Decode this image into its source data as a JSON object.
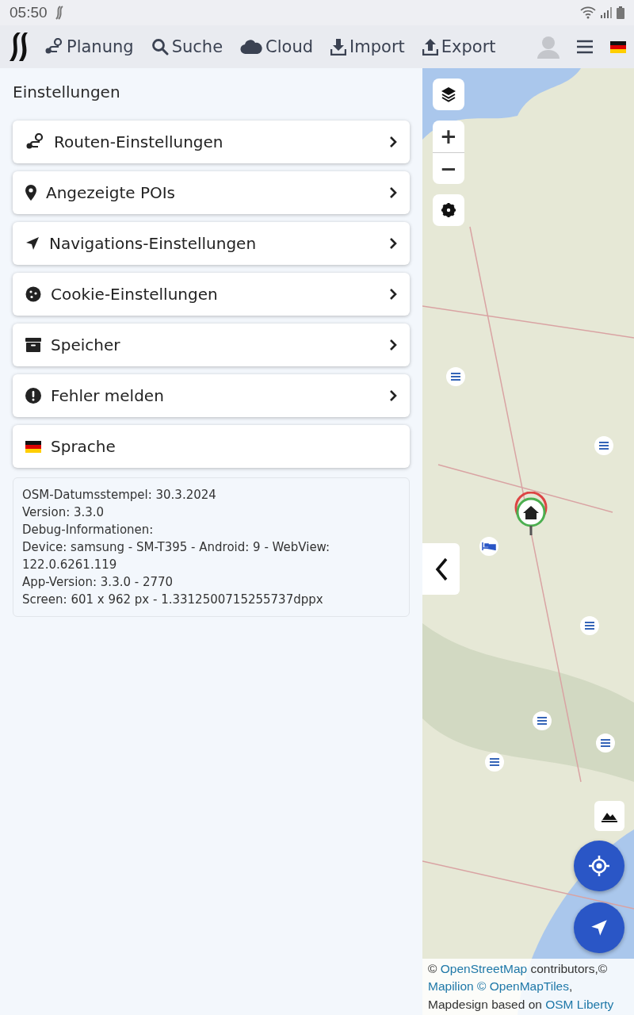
{
  "status_bar": {
    "time": "05:50"
  },
  "nav": {
    "items": [
      {
        "label": "Planung"
      },
      {
        "label": "Suche"
      },
      {
        "label": "Cloud"
      },
      {
        "label": "Import"
      },
      {
        "label": "Export"
      }
    ]
  },
  "settings": {
    "title": "Einstellungen",
    "items": [
      {
        "label": "Routen-Einstellungen",
        "kind": "link"
      },
      {
        "label": "Angezeigte POIs",
        "kind": "link"
      },
      {
        "label": "Navigations-Einstellungen",
        "kind": "link"
      },
      {
        "label": "Cookie-Einstellungen",
        "kind": "link"
      },
      {
        "label": "Speicher",
        "kind": "link"
      },
      {
        "label": "Fehler melden",
        "kind": "link"
      },
      {
        "label": "Sprache",
        "kind": "plain"
      }
    ],
    "info_lines": [
      "OSM-Datumsstempel: 30.3.2024",
      "Version: 3.3.0",
      "Debug-Informationen:",
      "Device: samsung - SM-T395 - Android: 9 - WebView: 122.0.6261.119",
      "App-Version: 3.3.0 - 2770",
      "Screen: 601 x 962 px - 1.3312500715255737dppx"
    ]
  },
  "map": {
    "zoom_in": "+",
    "zoom_out": "−",
    "attribution": [
      {
        "text": "© ",
        "link": false
      },
      {
        "text": "OpenStreetMap",
        "link": true
      },
      {
        "text": " contributors,© ",
        "link": false
      },
      {
        "text": "Mapilion © OpenMapTiles",
        "link": true
      },
      {
        "text": ", Mapdesign based on ",
        "link": false
      },
      {
        "text": "OSM Liberty",
        "link": true
      }
    ]
  }
}
